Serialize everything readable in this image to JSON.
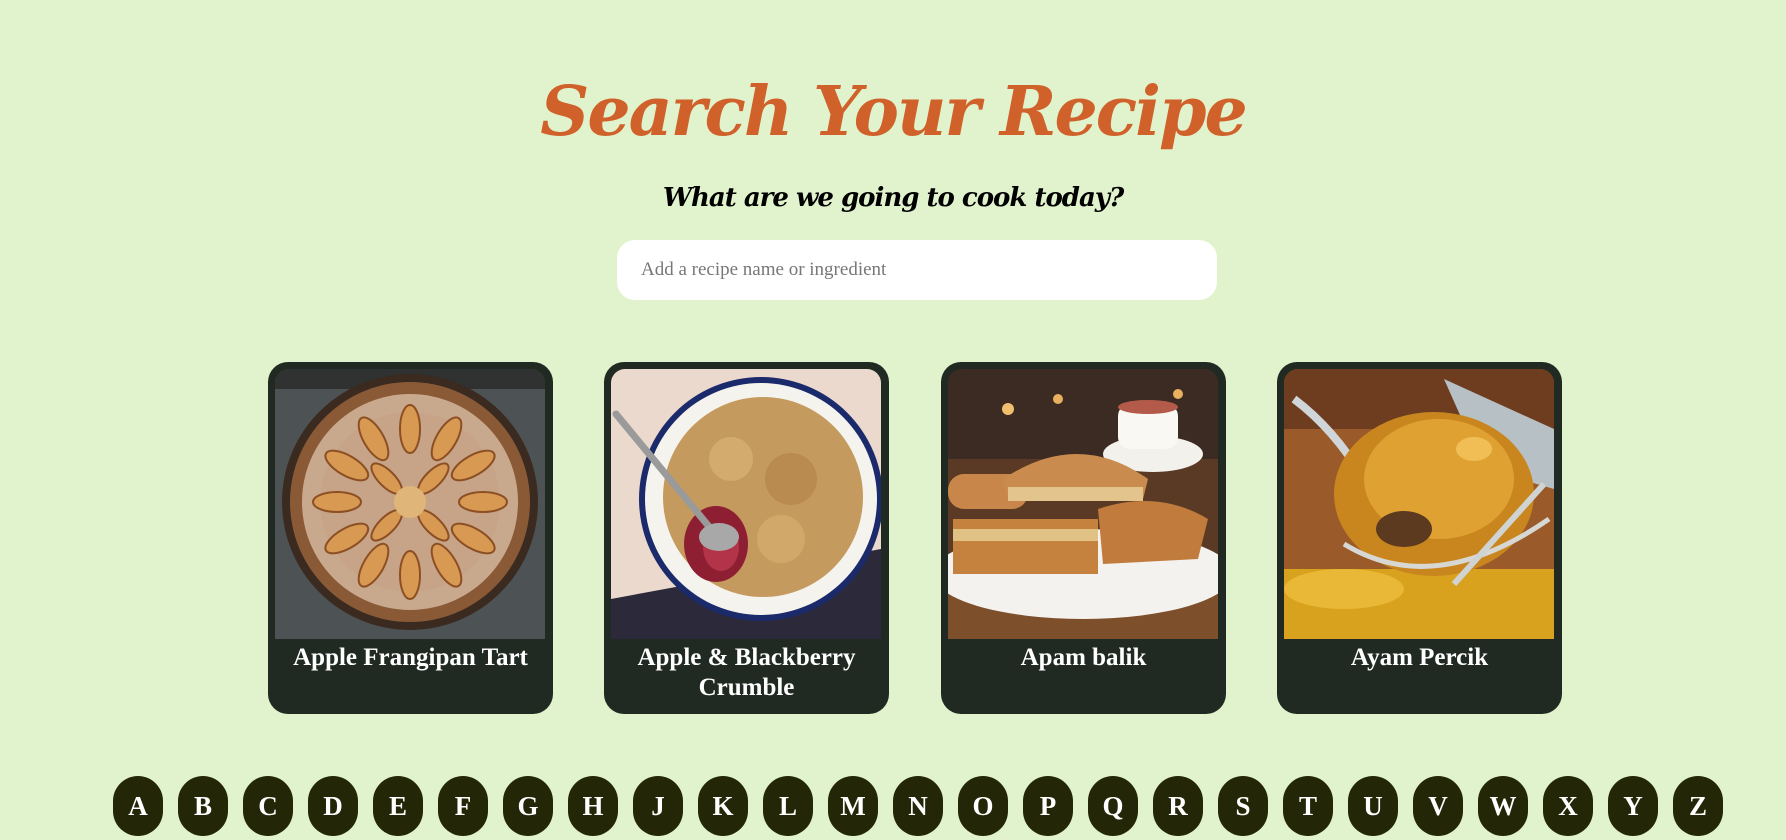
{
  "header": {
    "title": "Search Your Recipe",
    "subtitle": "What are we going to cook today?"
  },
  "search": {
    "placeholder": "Add a recipe name or ingredient",
    "value": ""
  },
  "recipes": [
    {
      "title": "Apple Frangipan Tart",
      "image": "apple-frangipan-tart-photo"
    },
    {
      "title": "Apple & Blackberry Crumble",
      "image": "apple-blackberry-crumble-photo"
    },
    {
      "title": "Apam balik",
      "image": "apam-balik-photo"
    },
    {
      "title": "Ayam Percik",
      "image": "ayam-percik-photo"
    }
  ],
  "alphabet": [
    "A",
    "B",
    "C",
    "D",
    "E",
    "F",
    "G",
    "H",
    "J",
    "K",
    "L",
    "M",
    "N",
    "O",
    "P",
    "Q",
    "R",
    "S",
    "T",
    "U",
    "V",
    "W",
    "X",
    "Y",
    "Z"
  ],
  "colors": {
    "background": "#e1f3cc",
    "title": "#d0612a",
    "card": "#202a22",
    "letter_button": "#232607"
  }
}
